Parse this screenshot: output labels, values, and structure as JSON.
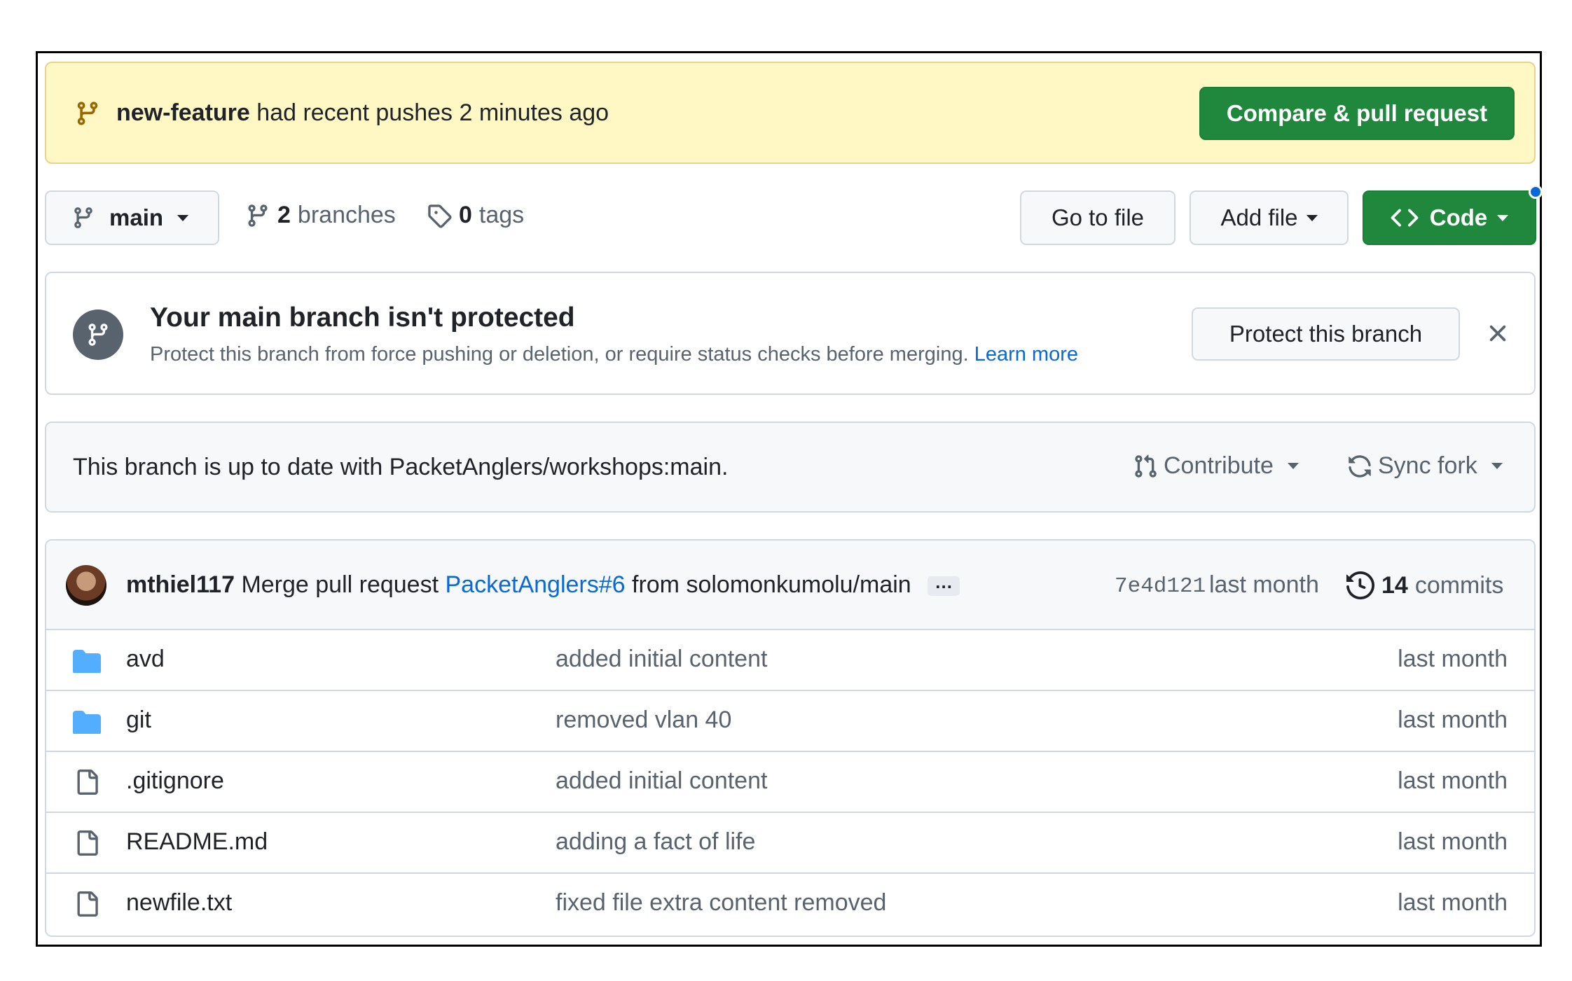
{
  "push_banner": {
    "branch": "new-feature",
    "message": "had recent pushes 2 minutes ago",
    "button": "Compare & pull request"
  },
  "branch_bar": {
    "current_branch": "main",
    "branches_count": "2",
    "branches_label": "branches",
    "tags_count": "0",
    "tags_label": "tags",
    "go_to_file": "Go to file",
    "add_file": "Add file",
    "code": "Code"
  },
  "protection": {
    "title": "Your main branch isn't protected",
    "description": "Protect this branch from force pushing or deletion, or require status checks before merging.",
    "learn_more": "Learn more",
    "button": "Protect this branch"
  },
  "sync": {
    "status": "This branch is up to date with PacketAnglers/workshops:main.",
    "contribute": "Contribute",
    "sync_fork": "Sync fork"
  },
  "latest_commit": {
    "author": "mthiel117",
    "message_prefix": "Merge pull request",
    "pr_link": "PacketAnglers#6",
    "message_suffix": "from solomonkumolu/main",
    "ellipsis": "…",
    "hash": "7e4d121",
    "time": "last month",
    "commits_count": "14",
    "commits_label": "commits"
  },
  "files": [
    {
      "type": "folder",
      "name": "avd",
      "message": "added initial content",
      "time": "last month"
    },
    {
      "type": "folder",
      "name": "git",
      "message": "removed vlan 40",
      "time": "last month"
    },
    {
      "type": "file",
      "name": ".gitignore",
      "message": "added initial content",
      "time": "last month"
    },
    {
      "type": "file",
      "name": "README.md",
      "message": "adding a fact of life",
      "time": "last month"
    },
    {
      "type": "file",
      "name": "newfile.txt",
      "message": "fixed file extra content removed",
      "time": "last month"
    }
  ],
  "colors": {
    "banner_bg": "#fff8c5",
    "primary_green": "#1f883d",
    "link_blue": "#0969da",
    "folder_blue": "#54aeff",
    "muted_text": "#59636e"
  }
}
